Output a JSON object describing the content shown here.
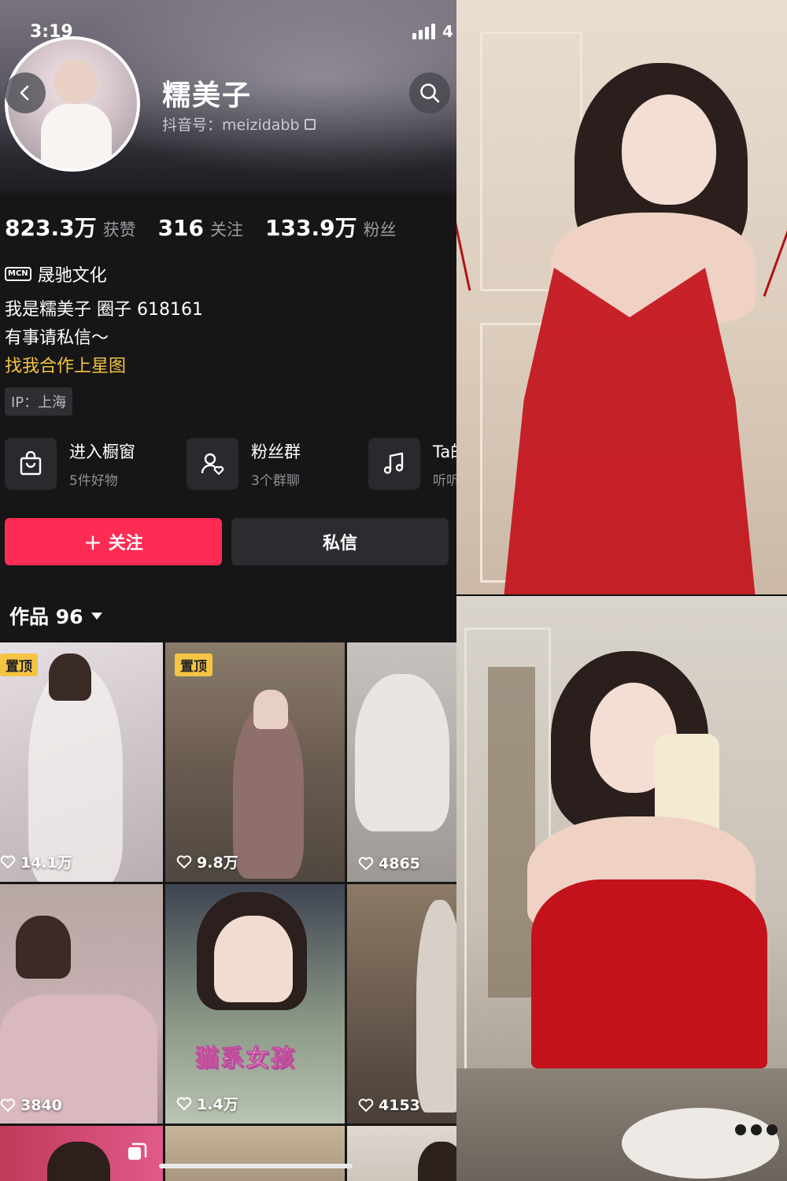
{
  "status": {
    "time": "3:19",
    "battery": "4"
  },
  "profile": {
    "name": "糯美子",
    "douyin_id": "抖音号：meizidabb",
    "stats": [
      {
        "value": "823.3万",
        "label": "获赞"
      },
      {
        "value": "316",
        "label": "关注"
      },
      {
        "value": "133.9万",
        "label": "粉丝"
      }
    ],
    "mcn_badge": "MCN",
    "mcn": "晟驰文化",
    "bio": [
      "我是糯美子 圈子 618161",
      "有事请私信～"
    ],
    "bio_link": "找我合作上星图",
    "ip": "IP：上海"
  },
  "services": [
    {
      "title": "进入橱窗",
      "sub": "5件好物",
      "icon": "shopping-bag-icon"
    },
    {
      "title": "粉丝群",
      "sub": "3个群聊",
      "icon": "fan-group-icon"
    },
    {
      "title": "Ta的",
      "sub": "听听t",
      "icon": "music-note-icon"
    }
  ],
  "actions": {
    "follow": "关注",
    "follow_plus": "+",
    "message": "私信"
  },
  "works": {
    "title": "作品 96",
    "pin_label": "置顶",
    "items": [
      {
        "likes": "14.1万",
        "pinned": true
      },
      {
        "likes": "9.8万",
        "pinned": true
      },
      {
        "likes": "4865",
        "pinned": false
      },
      {
        "likes": "3840",
        "pinned": false
      },
      {
        "likes": "1.4万",
        "pinned": false,
        "overlay": "猫系女孩"
      },
      {
        "likes": "4153",
        "pinned": false
      }
    ]
  },
  "colors": {
    "follow": "#fe2c55",
    "pin": "#f5c443",
    "link": "#f5c443",
    "dress": "#c3121c"
  }
}
